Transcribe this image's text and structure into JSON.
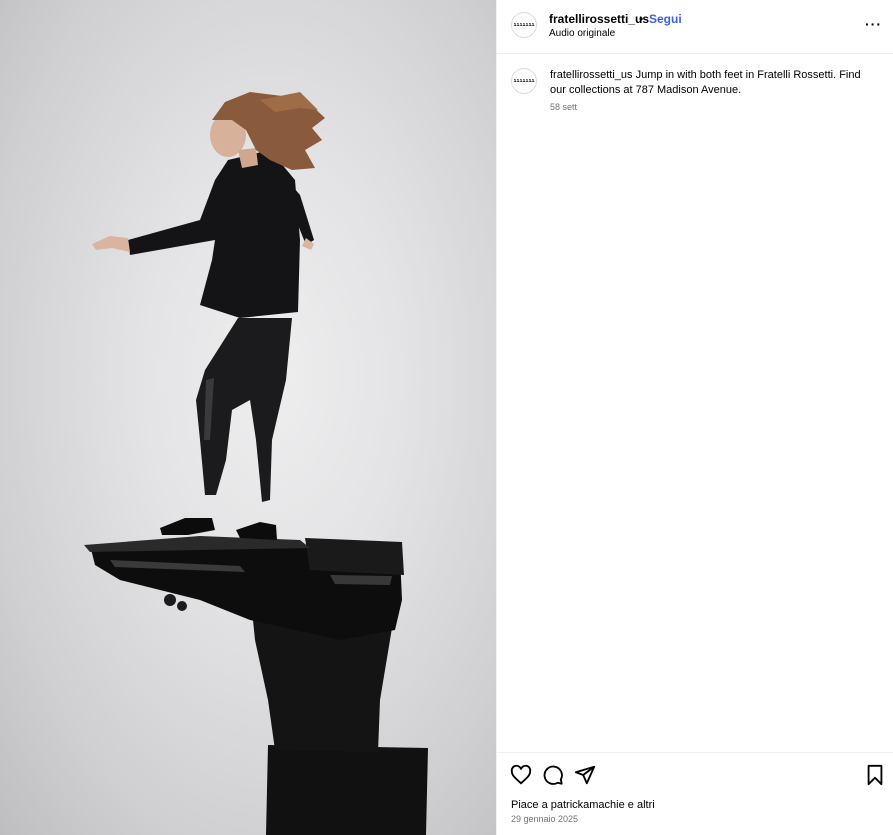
{
  "post": {
    "username": "fratellirossetti_us",
    "separator": "•",
    "follow_label": "Segui",
    "audio_label": "Audio originale",
    "more_label": "···",
    "avatar_logo": "ııııııı"
  },
  "caption": {
    "username": "fratellirossetti_us",
    "text": "Jump in with both feet in Fratelli Rossetti. Find our collections at 787 Madison Avenue.",
    "time": "58 sett"
  },
  "actions": {
    "likes_text": "Piace a patrickamachie e altri",
    "date": "29 gennaio 2025",
    "icons": [
      "heart-icon",
      "comment-icon",
      "share-icon",
      "bookmark-icon"
    ]
  },
  "colors": {
    "follow_blue": "#3e5ee6",
    "muted_gray": "#737373",
    "divider": "#efefef"
  }
}
